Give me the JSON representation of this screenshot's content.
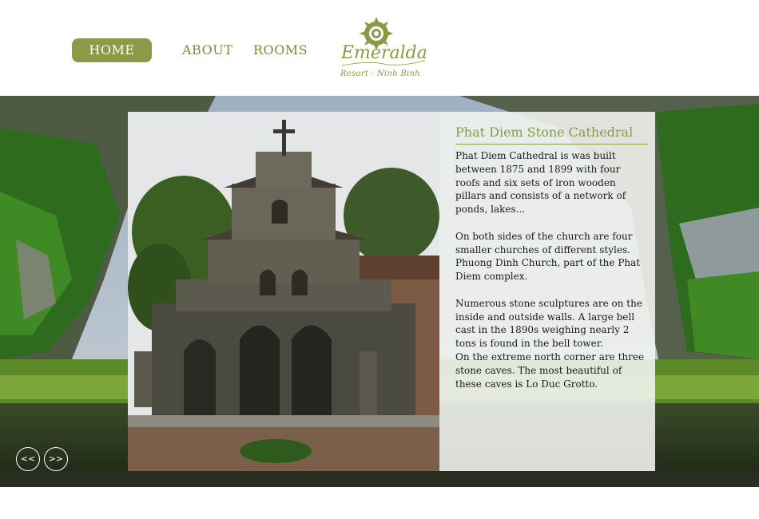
{
  "nav": {
    "home_label": "HOME",
    "about_label": "ABOUT",
    "rooms_label": "ROOMS"
  },
  "logo": {
    "name": "Emeralda",
    "tagline": "Resort - Ninh Binh",
    "accent_color": "#8a9a46"
  },
  "article": {
    "title": "Phat Diem Stone Cathedral",
    "paragraphs": [
      "Phat Diem Cathedral is was built between 1875 and 1899 with four roofs and six sets of iron wooden pillars and consists of a network of ponds, lakes...",
      "On both sides of the church are four smaller churches of different styles. Phuong Dinh Church, part of the Phat Diem complex.",
      "Numerous stone sculptures are on the inside and outside walls. A large bell cast in the 1890s weighing nearly 2 tons is found in the bell tower.",
      "On the extreme north corner are three stone caves. The most beautiful of these caves is Lo Duc Grotto."
    ]
  },
  "slider": {
    "prev_label": "<<",
    "next_label": ">>"
  }
}
